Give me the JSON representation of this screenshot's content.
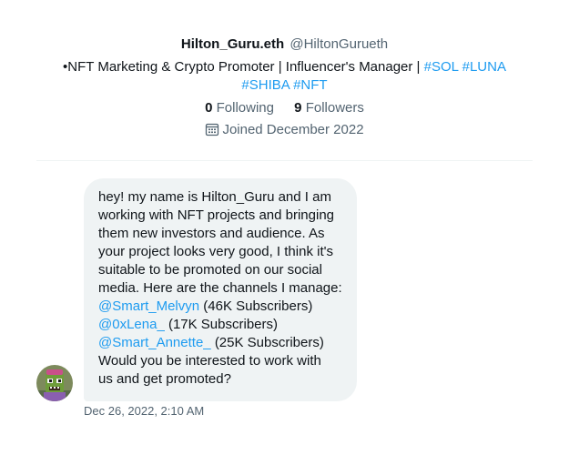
{
  "profile": {
    "display_name": "Hilton_Guru.eth",
    "handle": "@HiltonGurueth",
    "bio_text": "•NFT Marketing & Crypto Promoter | Influencer's Manager |",
    "bio_hashtags": [
      "#SOL",
      "#LUNA",
      "#SHIBA",
      "#NFT"
    ],
    "following_count": "0",
    "following_label": "Following",
    "followers_count": "9",
    "followers_label": "Followers",
    "joined": "Joined December 2022"
  },
  "message": {
    "lines": [
      "hey! my name is Hilton_Guru and I am",
      "working with NFT projects and bringing",
      "them new investors and audience. As",
      "your project looks very good, I think it's",
      "suitable to be promoted on our social",
      "media. Here are the channels I manage:"
    ],
    "channels": [
      {
        "mention": "@Smart_Melvyn",
        "subs": "(46K Subscribers)"
      },
      {
        "mention": "@0xLena_",
        "subs": "(17K Subscribers)"
      },
      {
        "mention": "@Smart_Annette_",
        "subs": "(25K Subscribers)"
      }
    ],
    "closing_lines": [
      "Would you be interested to work with",
      "us and get promoted?"
    ],
    "timestamp": "Dec 26, 2022, 2:10 AM"
  },
  "colors": {
    "link": "#1d9bf0",
    "muted": "#536471",
    "bubble": "#eff3f4",
    "text": "#0f1419"
  },
  "icons": {
    "calendar": "calendar-icon"
  }
}
